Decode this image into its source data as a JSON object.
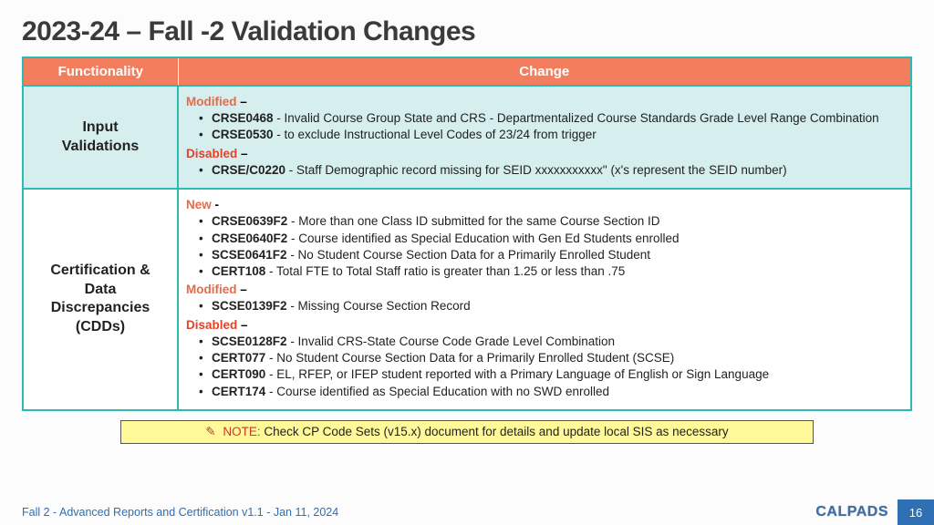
{
  "title": "2023-24 – Fall -2 Validation Changes",
  "headers": {
    "c1": "Functionality",
    "c2": "Change"
  },
  "rows": [
    {
      "head": "Input Validations",
      "hl": true,
      "groups": [
        {
          "tag": "Modified",
          "cls": "mod",
          "items": [
            {
              "code": "CRSE0468",
              "text": " - Invalid Course Group State and CRS - Departmentalized Course Standards Grade Level Range Combination"
            },
            {
              "code": "CRSE0530",
              "text": " - to exclude Instructional Level Codes of 23/24 from trigger"
            }
          ]
        },
        {
          "tag": "Disabled",
          "cls": "dis",
          "items": [
            {
              "code": "CRSE/C0220",
              "text": " - Staff Demographic record missing for SEID xxxxxxxxxxx\" (x's represent the SEID number)"
            }
          ]
        }
      ]
    },
    {
      "head": "Certification & Data Discrepancies (CDDs)",
      "hl": false,
      "groups": [
        {
          "tag": "New",
          "cls": "new",
          "suffix": " -",
          "items": [
            {
              "code": "CRSE0639F2",
              "text": " - More than one Class ID submitted for the same Course Section ID"
            },
            {
              "code": "CRSE0640F2",
              "text": " - Course identified as Special Education with Gen Ed Students enrolled"
            },
            {
              "code": "SCSE0641F2",
              "text": " - No Student Course Section Data for a Primarily Enrolled Student"
            },
            {
              "code": "CERT108",
              "text": " - Total FTE to Total Staff ratio is greater than 1.25 or less than .75"
            }
          ]
        },
        {
          "tag": "Modified",
          "cls": "mod",
          "items": [
            {
              "code": "SCSE0139F2",
              "text": " - Missing Course Section Record"
            }
          ]
        },
        {
          "tag": "Disabled",
          "cls": "dis",
          "items": [
            {
              "code": "SCSE0128F2",
              "text": " - Invalid CRS-State Course Code Grade Level Combination"
            },
            {
              "code": "CERT077",
              "text": " - No Student Course Section Data for a Primarily Enrolled Student (SCSE)"
            },
            {
              "code": "CERT090",
              "text": " - EL, RFEP, or IFEP student reported with a Primary Language of English or Sign Language"
            },
            {
              "code": "CERT174",
              "text": " - Course identified as Special Education with no SWD enrolled"
            }
          ]
        }
      ]
    }
  ],
  "note": {
    "label": "NOTE:",
    "text": "  Check CP Code Sets (v15.x) document for details and update local SIS as necessary"
  },
  "footer": {
    "text": "Fall 2 - Advanced Reports and Certification v1.1 - Jan 11, 2024",
    "logo": "CALPADS",
    "page": "16"
  }
}
